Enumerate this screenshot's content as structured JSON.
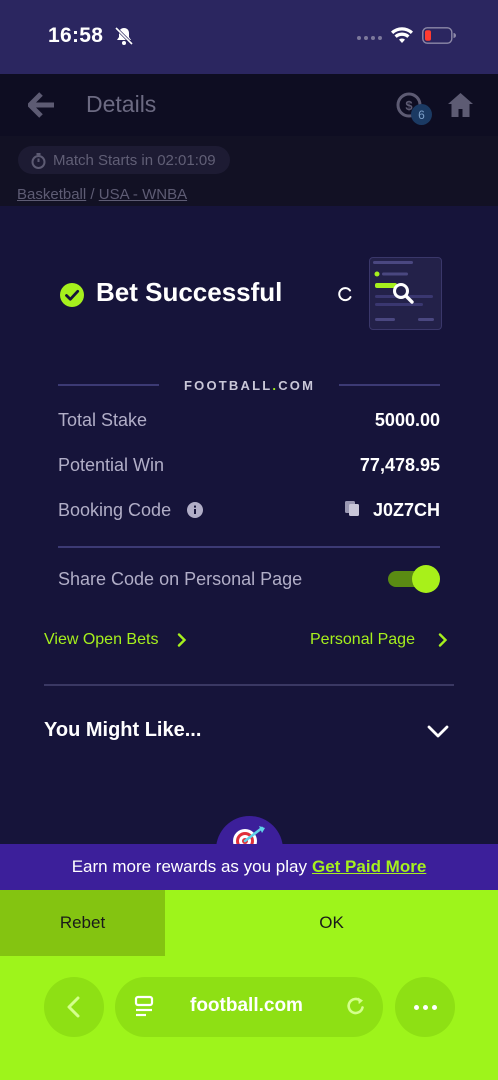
{
  "status_bar": {
    "time": "16:58"
  },
  "header": {
    "title": "Details",
    "cashout_badge": "6"
  },
  "match": {
    "starts_text": "Match Starts in 02:01:09"
  },
  "breadcrumb": {
    "sport": "Basketball",
    "separator": "/",
    "league": "USA - WNBA"
  },
  "bet": {
    "title": "Bet Successful",
    "brand": "FOOTBALL",
    "brand_dot": ".",
    "brand_suffix": "COM",
    "total_stake_label": "Total Stake",
    "total_stake": "5000.00",
    "potential_win_label": "Potential Win",
    "potential_win": "77,478.95",
    "booking_code_label": "Booking Code",
    "booking_code": "J0Z7CH",
    "share_label": "Share Code on Personal Page",
    "share_enabled": true,
    "view_open_bets": "View Open Bets",
    "personal_page": "Personal Page",
    "you_might_like": "You Might Like..."
  },
  "rewards": {
    "text": "Earn more rewards as you play",
    "link": "Get Paid More"
  },
  "actions": {
    "rebet": "Rebet",
    "ok": "OK"
  },
  "browser": {
    "url": "football.com"
  },
  "colors": {
    "accent": "#a6f01d",
    "sheet_bg": "#16143a",
    "banner": "#3c1f9a"
  }
}
